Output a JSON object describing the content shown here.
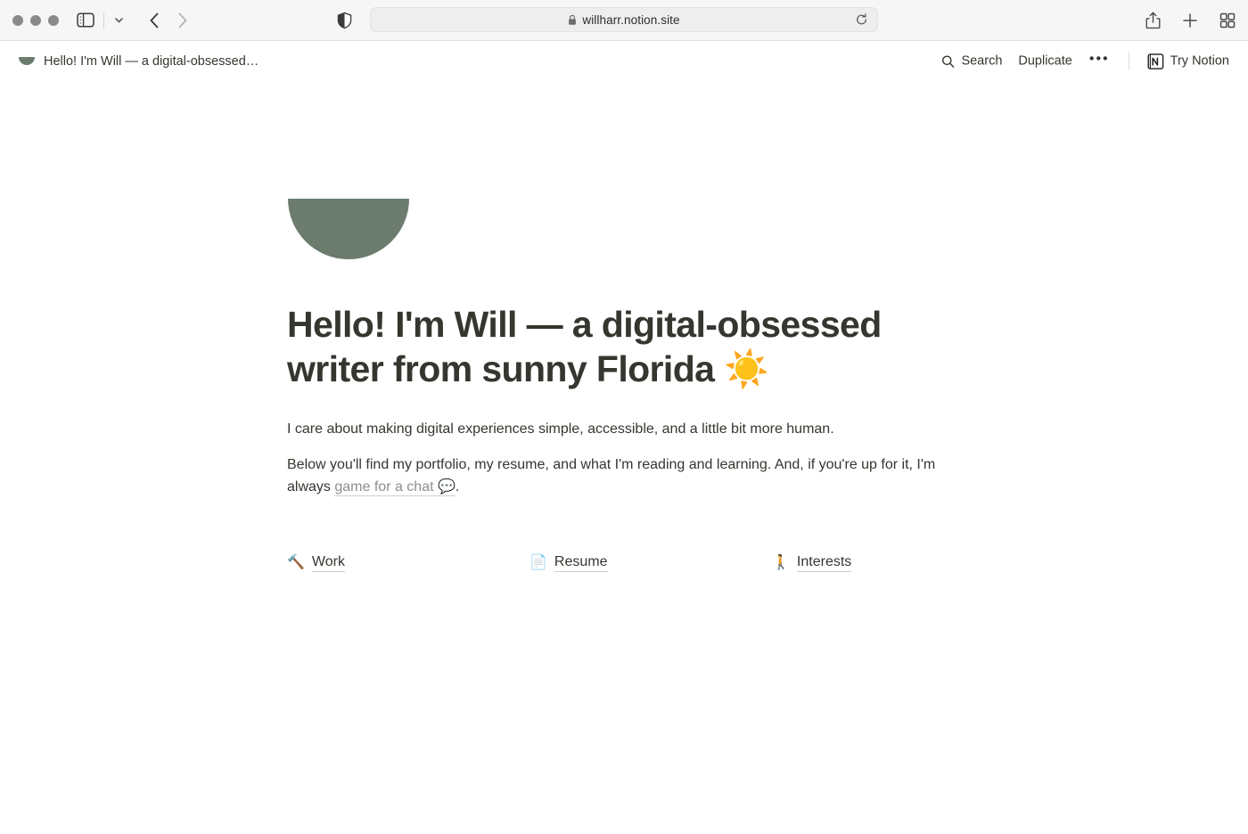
{
  "browser": {
    "traffic_lights": [
      "close",
      "minimize",
      "zoom"
    ],
    "sidebar_toggle_icon": "sidebar-icon",
    "sidebar_chevron_icon": "chevron-down-icon",
    "back_icon": "chevron-left-icon",
    "forward_icon": "chevron-right-icon",
    "shield_icon": "privacy-shield-icon",
    "url": "willharr.notion.site",
    "url_lock_icon": "lock-icon",
    "reload_icon": "reload-icon",
    "share_icon": "share-icon",
    "new_tab_icon": "plus-icon",
    "tab_overview_icon": "tab-grid-icon"
  },
  "topbar": {
    "breadcrumb_icon": "half-circle-icon",
    "breadcrumb_title": "Hello! I'm Will — a digital-obsessed…",
    "search_label": "Search",
    "search_icon": "search-icon",
    "duplicate_label": "Duplicate",
    "more_label": "•••",
    "notion_logo_icon": "notion-logo-icon",
    "try_notion_label": "Try Notion"
  },
  "page": {
    "icon": "half-circle-icon",
    "icon_color": "#6b7c6e",
    "title": "Hello! I'm Will — a digital-obsessed writer from sunny Florida ☀️",
    "paragraph_1": "I care about making digital experiences simple, accessible, and a little bit more human.",
    "paragraph_2_before": "Below you'll find my portfolio, my resume, and what I'm reading and learning. And, if you're up for it, I'm always ",
    "paragraph_2_link": "game for a chat 💬",
    "paragraph_2_after": ".",
    "columns": [
      {
        "emoji": "🔨",
        "label": "Work",
        "emoji_name": "hammer-emoji"
      },
      {
        "emoji": "📄",
        "label": "Resume",
        "emoji_name": "page-emoji"
      },
      {
        "emoji": "🚶",
        "label": "Interests",
        "emoji_name": "walking-person-emoji"
      }
    ]
  }
}
